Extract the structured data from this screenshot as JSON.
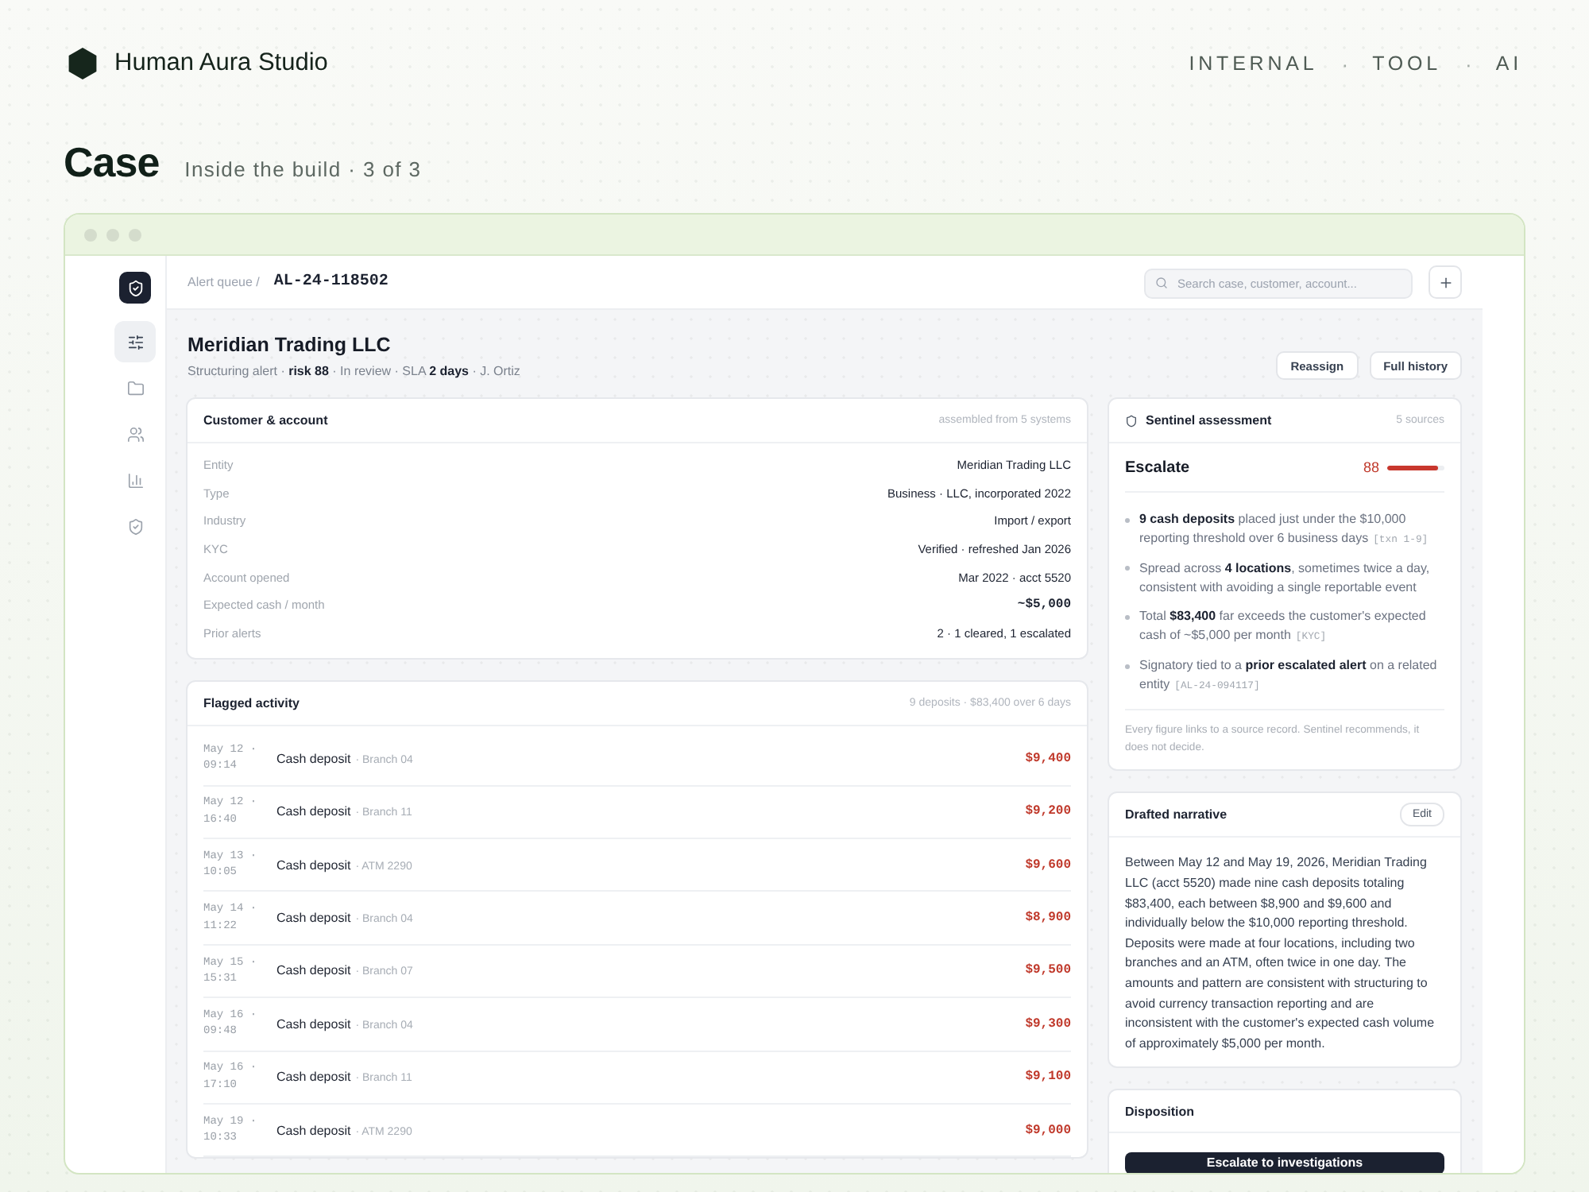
{
  "brand": {
    "name": "Human Aura Studio"
  },
  "nav": [
    {
      "kind": "tag",
      "label": "INTERNAL"
    },
    {
      "kind": "separator",
      "label": "·"
    },
    {
      "kind": "tag",
      "label": "TOOL"
    },
    {
      "kind": "separator",
      "label": "·"
    },
    {
      "kind": "tag",
      "label": "AI"
    }
  ],
  "page": {
    "title": "Case",
    "subtitle": "Inside the build · 3 of 3"
  },
  "app": {
    "sidebar": {
      "items": [
        {
          "kind": "filters",
          "selected": true
        },
        {
          "kind": "folder",
          "selected": false
        },
        {
          "kind": "people",
          "selected": false
        },
        {
          "kind": "chart",
          "selected": false
        },
        {
          "kind": "shield",
          "selected": false
        }
      ]
    },
    "breadcrumb": {
      "parent": "Alert queue /",
      "current": "AL-24-118502"
    },
    "search": {
      "placeholder": "Search case, customer, account..."
    },
    "case": {
      "title": "Meridian Trading LLC",
      "meta": "Structuring alert · **risk 88** · In review · SLA **2 days** · J. Ortiz",
      "actions": [
        "Reassign",
        "Full history"
      ]
    },
    "customer": {
      "title": "Customer & account",
      "note": "assembled from 5 systems",
      "fields": [
        {
          "kind": "text",
          "label": "Entity",
          "value": "Meridian Trading LLC"
        },
        {
          "kind": "text",
          "label": "Type",
          "value": "Business · LLC, incorporated 2022"
        },
        {
          "kind": "text",
          "label": "Industry",
          "value": "Import / export"
        },
        {
          "kind": "text",
          "label": "KYC",
          "value": "Verified · refreshed Jan 2026"
        },
        {
          "kind": "text",
          "label": "Account opened",
          "value": "Mar 2022 · acct 5520"
        },
        {
          "kind": "amount",
          "label": "Expected cash / month",
          "value": "~$5,000"
        },
        {
          "kind": "text",
          "label": "Prior alerts",
          "value": "2 · 1 cleared, 1 escalated"
        }
      ]
    },
    "activity": {
      "title": "Flagged activity",
      "note": "9 deposits · $83,400 over 6 days",
      "rows": [
        {
          "when": "May 12 · 09:14",
          "type": "Cash deposit",
          "detail": "· Branch 04",
          "amount": "$9,400"
        },
        {
          "when": "May 12 · 16:40",
          "type": "Cash deposit",
          "detail": "· Branch 11",
          "amount": "$9,200"
        },
        {
          "when": "May 13 · 10:05",
          "type": "Cash deposit",
          "detail": "· ATM 2290",
          "amount": "$9,600"
        },
        {
          "when": "May 14 · 11:22",
          "type": "Cash deposit",
          "detail": "· Branch 04",
          "amount": "$8,900"
        },
        {
          "when": "May 15 · 15:31",
          "type": "Cash deposit",
          "detail": "· Branch 07",
          "amount": "$9,500"
        },
        {
          "when": "May 16 · 09:48",
          "type": "Cash deposit",
          "detail": "· Branch 04",
          "amount": "$9,300"
        },
        {
          "when": "May 16 · 17:10",
          "type": "Cash deposit",
          "detail": "· Branch 11",
          "amount": "$9,100"
        },
        {
          "when": "May 19 · 10:33",
          "type": "Cash deposit",
          "detail": "· ATM 2290",
          "amount": "$9,000"
        }
      ]
    },
    "sentinel": {
      "title": "Sentinel assessment",
      "note": "5 sources",
      "verdict": "Escalate",
      "score": "88",
      "level": 0.88,
      "findings": [
        {
          "text": "**9 cash deposits** placed just under the $10,000 reporting threshold over 6 business days",
          "ref": "[txn 1-9]"
        },
        {
          "text": "Spread across **4 locations**, sometimes twice a day, consistent with avoiding a single reportable event"
        },
        {
          "text": "Total **$83,400** far exceeds the customer's expected cash of ~$5,000 per month",
          "ref": "[KYC]"
        },
        {
          "text": "Signatory tied to a **prior escalated alert** on a related entity",
          "ref": "[AL-24-094117]"
        }
      ],
      "footnote": "Every figure links to a source record. Sentinel recommends, it does not decide."
    },
    "narrative": {
      "title": "Drafted narrative",
      "action": "Edit",
      "text": "Between May 12 and May 19, 2026, Meridian Trading LLC (acct 5520) made nine cash deposits totaling $83,400, each between $8,900 and $9,600 and individually below the $10,000 reporting threshold. Deposits were made at four locations, including two branches and an ATM, often twice in one day. The amounts and pattern are consistent with structuring to avoid currency transaction reporting and are inconsistent with the customer's expected cash volume of approximately $5,000 per month."
    },
    "disposition": {
      "title": "Disposition",
      "action": "Escalate to investigations"
    }
  }
}
